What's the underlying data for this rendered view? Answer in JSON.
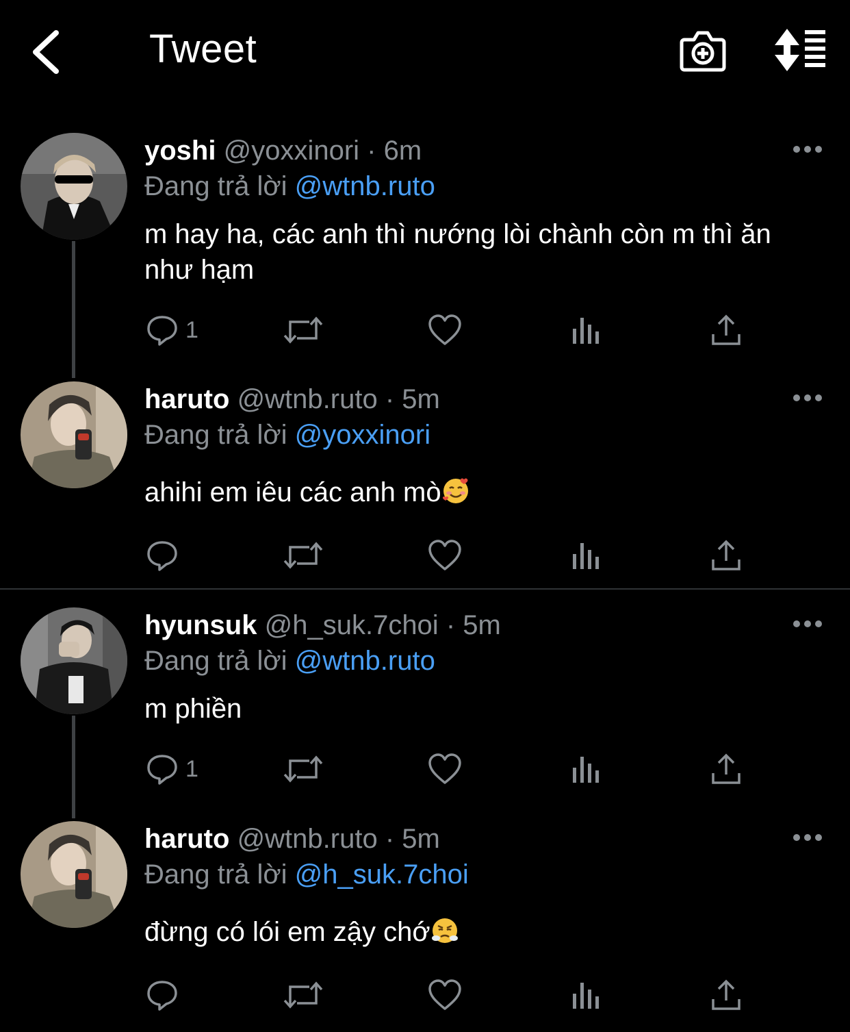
{
  "header": {
    "title": "Tweet"
  },
  "reply_prefix": "Đang trả lời",
  "tweets": [
    {
      "name": "yoshi",
      "handle": "@yoxxinori",
      "dot": "·",
      "time": "6m",
      "reply_to": "@wtnb.ruto",
      "text": "m hay ha, các anh thì nướng lòi chành còn m thì ăn như hạm",
      "reply_count": "1"
    },
    {
      "name": "haruto",
      "handle": "@wtnb.ruto",
      "dot": "·",
      "time": "5m",
      "reply_to": "@yoxxinori",
      "text": "ahihi em iêu các anh mò",
      "reply_count": ""
    },
    {
      "name": "hyunsuk",
      "handle": "@h_suk.7choi",
      "dot": "·",
      "time": "5m",
      "reply_to": "@wtnb.ruto",
      "text": "m phiền",
      "reply_count": "1"
    },
    {
      "name": "haruto",
      "handle": "@wtnb.ruto",
      "dot": "·",
      "time": "5m",
      "reply_to": "@h_suk.7choi",
      "text": "đừng có lói em zậy chớ",
      "reply_count": ""
    }
  ],
  "colors": {
    "background": "#000000",
    "mention": "#4a9ff5",
    "secondary_text": "#8b9095",
    "thread_line": "#3e4144"
  },
  "icons": [
    "back-chevron-icon",
    "camera-add-icon",
    "sort-icon",
    "more-icon",
    "reply-icon",
    "retweet-icon",
    "like-icon",
    "analytics-icon",
    "share-icon",
    "smiling-hearts-emoji",
    "steam-nose-emoji"
  ]
}
